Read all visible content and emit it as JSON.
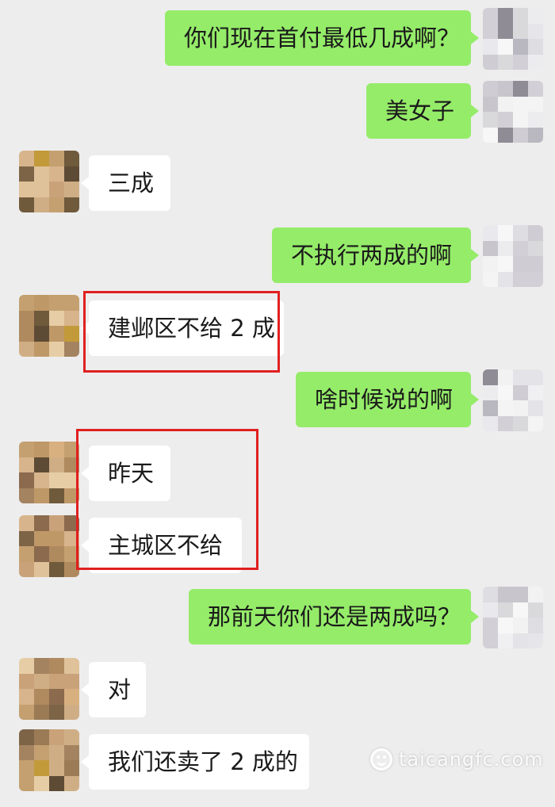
{
  "messages": [
    {
      "sender": "me",
      "text": "你们现在首付最低几成啊？"
    },
    {
      "sender": "me",
      "text": "美女子"
    },
    {
      "sender": "contact",
      "text": "三成"
    },
    {
      "sender": "me",
      "text": "不执行两成的啊"
    },
    {
      "sender": "contact",
      "text": "建邺区不给 2 成"
    },
    {
      "sender": "me",
      "text": "啥时候说的啊"
    },
    {
      "sender": "contact",
      "text": "昨天"
    },
    {
      "sender": "contact",
      "text": "主城区不给"
    },
    {
      "sender": "me",
      "text": "那前天你们还是两成吗？"
    },
    {
      "sender": "contact",
      "text": "对"
    },
    {
      "sender": "contact",
      "text": "我们还卖了 2 成的"
    }
  ],
  "watermark": {
    "text": "taicangfc.com"
  },
  "colors": {
    "background": "#ededed",
    "outgoing_bubble": "#95ec69",
    "incoming_bubble": "#ffffff",
    "highlight_box": "#e02020"
  }
}
